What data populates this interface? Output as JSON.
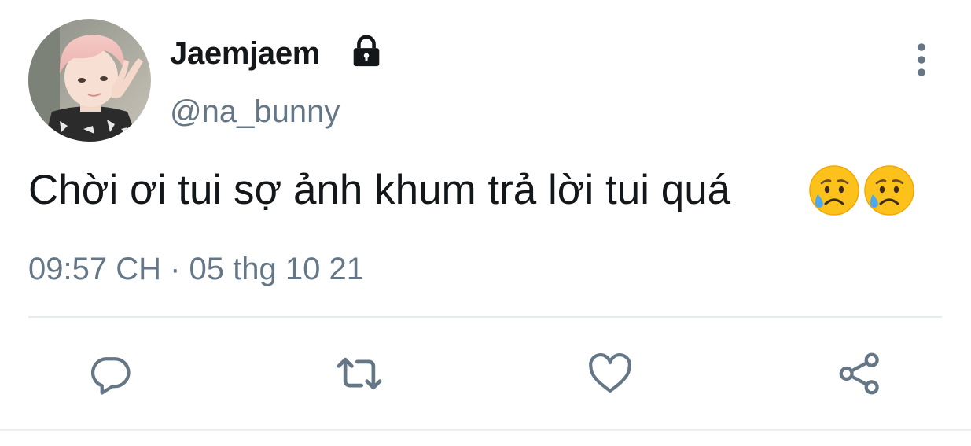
{
  "user": {
    "display_name": "Jaemjaem",
    "handle": "@na_bunny",
    "protected": true
  },
  "tweet": {
    "text": "Chời ơi tui sợ ảnh khum trả lời tui quá",
    "emojis": [
      "sad-but-relieved-face",
      "sad-but-relieved-face"
    ],
    "timestamp": "09:57 CH · 05 thg 10 21"
  },
  "icons": {
    "lock": "lock-icon",
    "more": "more-vertical-icon",
    "reply": "reply-icon",
    "retweet": "retweet-icon",
    "like": "heart-icon",
    "share": "share-icon"
  },
  "colors": {
    "text_primary": "#14171a",
    "text_secondary": "#657786",
    "icon_gray": "#657786",
    "divider": "#e6ecf0"
  }
}
